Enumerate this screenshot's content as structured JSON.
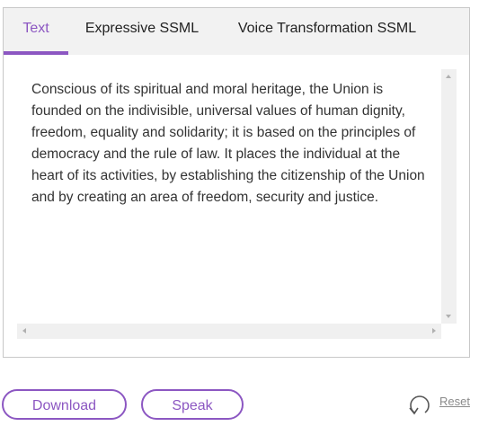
{
  "tabs": [
    {
      "label": "Text",
      "active": true
    },
    {
      "label": "Expressive SSML",
      "active": false
    },
    {
      "label": "Voice Transformation SSML",
      "active": false
    }
  ],
  "editor": {
    "text": "Conscious of its spiritual and moral heritage, the Union is founded on the indivisible, universal values of human dignity, freedom, equality and solidarity; it is based on the principles of democracy and the rule of law. It places the individual at the heart of its activities, by establishing the citizenship of the Union and by creating an area of freedom, security and justice."
  },
  "actions": {
    "download_label": "Download",
    "speak_label": "Speak",
    "reset_label": "Reset"
  },
  "colors": {
    "accent": "#8c57c2",
    "tab_bar": "#f2f2f2",
    "text": "#333333"
  },
  "icons": {
    "reset": "undo-arrow-icon"
  }
}
